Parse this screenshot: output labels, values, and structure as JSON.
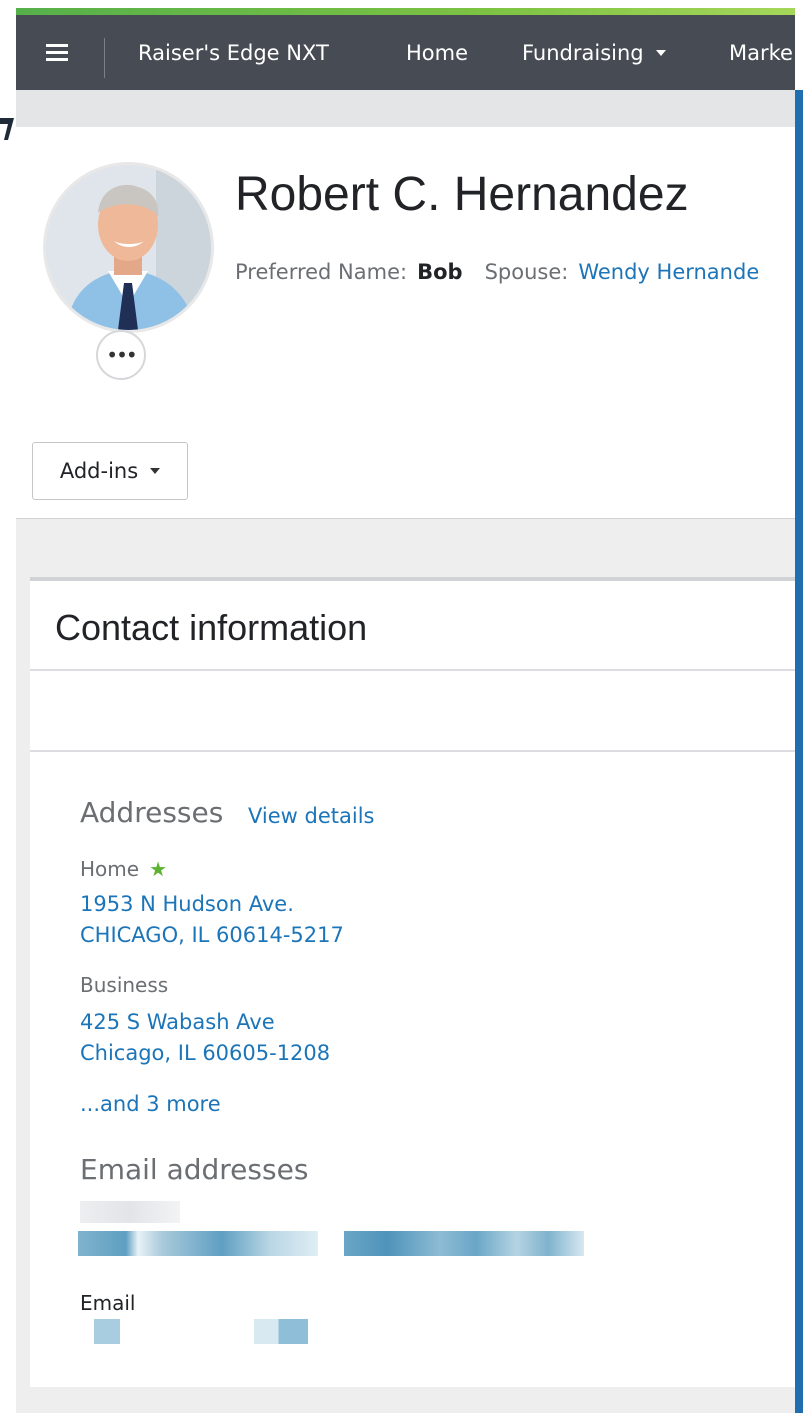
{
  "navbar": {
    "app_name": "Raiser's Edge NXT",
    "items": [
      {
        "label": "Home"
      },
      {
        "label": "Fundraising"
      },
      {
        "label": "Marke"
      }
    ]
  },
  "constituent": {
    "name": "Robert C. Hernandez",
    "preferred_label": "Preferred Name:",
    "preferred_value": "Bob",
    "spouse_label": "Spouse:",
    "spouse_value": "Wendy Hernande"
  },
  "toolbar": {
    "addins_label": "Add-ins"
  },
  "contact": {
    "title": "Contact information",
    "addresses_title": "Addresses",
    "view_details": "View details",
    "home_label": "Home",
    "home_line1": "1953 N Hudson Ave.",
    "home_line2": "CHICAGO, IL  60614-5217",
    "business_label": "Business",
    "business_line1": "425 S Wabash Ave",
    "business_line2": "Chicago, IL  60605-1208",
    "more_link": "...and 3 more",
    "emails_title": "Email addresses",
    "email_label": "Email"
  },
  "colors": {
    "navbar": "#474c54",
    "accent_green": "#7cc243",
    "link_blue": "#1c75b8",
    "primary_star": "#5cb331"
  },
  "icons": [
    "menu-icon",
    "caret-down-icon",
    "ellipsis-icon",
    "star-icon"
  ]
}
